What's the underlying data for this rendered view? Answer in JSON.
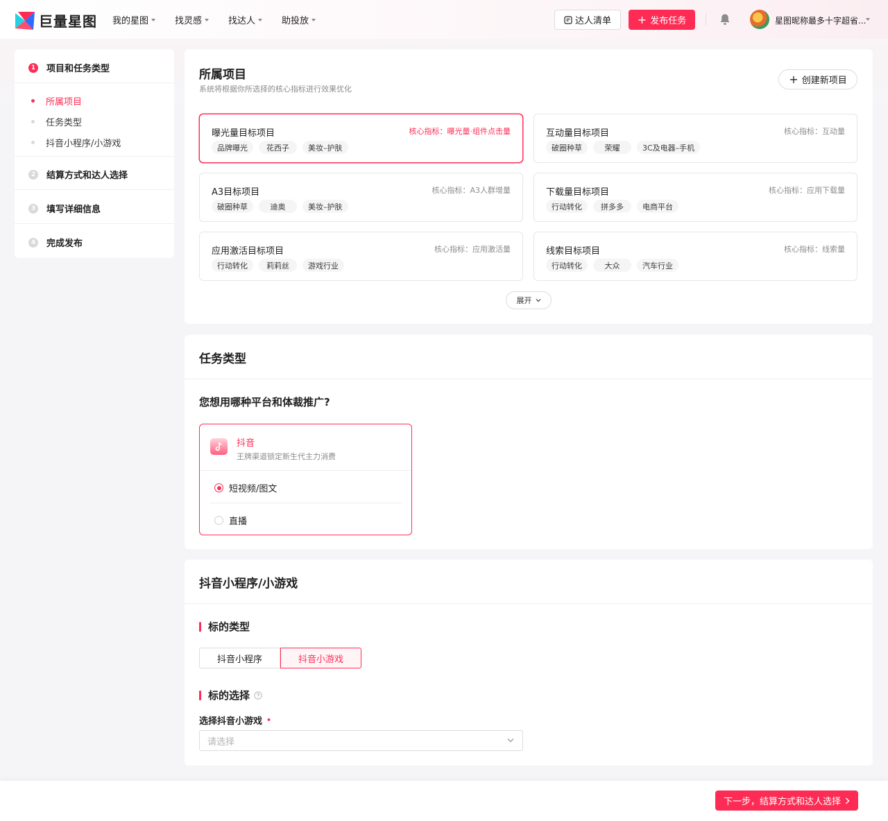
{
  "brand": {
    "name": "巨量星图",
    "accent": "#fe2c55"
  },
  "header": {
    "nav": [
      "我的星图",
      "找灵感",
      "找达人",
      "助投放"
    ],
    "list_button": "达人清单",
    "publish_button": "发布任务",
    "user_name": "星图昵称最多十字超省..."
  },
  "sidebar": {
    "steps": [
      {
        "num": "1",
        "label": "项目和任务类型",
        "active": true
      },
      {
        "num": "2",
        "label": "结算方式和达人选择"
      },
      {
        "num": "3",
        "label": "填写详细信息"
      },
      {
        "num": "4",
        "label": "完成发布"
      }
    ],
    "subitems": [
      "所属项目",
      "任务类型",
      "抖音小程序/小游戏"
    ]
  },
  "project_section": {
    "title": "所属项目",
    "subtitle": "系统将根据你所选择的核心指标进行效果优化",
    "create_button": "创建新项目",
    "expand_button": "展开",
    "cards": [
      {
        "name": "曝光量目标项目",
        "metric": "核心指标：曝光量·组件点击量",
        "tags": [
          "品牌曝光",
          "花西子",
          "美妆–护肤"
        ],
        "selected": true
      },
      {
        "name": "互动量目标项目",
        "metric": "核心指标：互动量",
        "tags": [
          "破圈种草",
          "荣耀",
          "3C及电器–手机"
        ]
      },
      {
        "name": "A3目标项目",
        "metric": "核心指标：A3人群增量",
        "tags": [
          "破圈种草",
          "迪奥",
          "美妆–护肤"
        ]
      },
      {
        "name": "下载量目标项目",
        "metric": "核心指标：应用下载量",
        "tags": [
          "行动转化",
          "拼多多",
          "电商平台"
        ]
      },
      {
        "name": "应用激活目标项目",
        "metric": "核心指标：应用激活量",
        "tags": [
          "行动转化",
          "莉莉丝",
          "游戏行业"
        ]
      },
      {
        "name": "线索目标项目",
        "metric": "核心指标：线索量",
        "tags": [
          "行动转化",
          "大众",
          "汽车行业"
        ]
      }
    ]
  },
  "task_section": {
    "title": "任务类型",
    "question": "您想用哪种平台和体裁推广?",
    "platform": {
      "name": "抖音",
      "desc": "王牌渠道锁定新生代主力消费",
      "options": [
        {
          "label": "短视频/图文",
          "checked": true
        },
        {
          "label": "直播",
          "checked": false
        }
      ]
    }
  },
  "mini_section": {
    "title": "抖音小程序/小游戏",
    "target_type_label": "标的类型",
    "target_types": [
      "抖音小程序",
      "抖音小游戏"
    ],
    "selected_type": "抖音小游戏",
    "target_select_label": "标的选择",
    "field_label": "选择抖音小游戏",
    "required_mark": "•",
    "select_placeholder": "请选择"
  },
  "footer": {
    "next_button": "下一步，结算方式和达人选择"
  }
}
